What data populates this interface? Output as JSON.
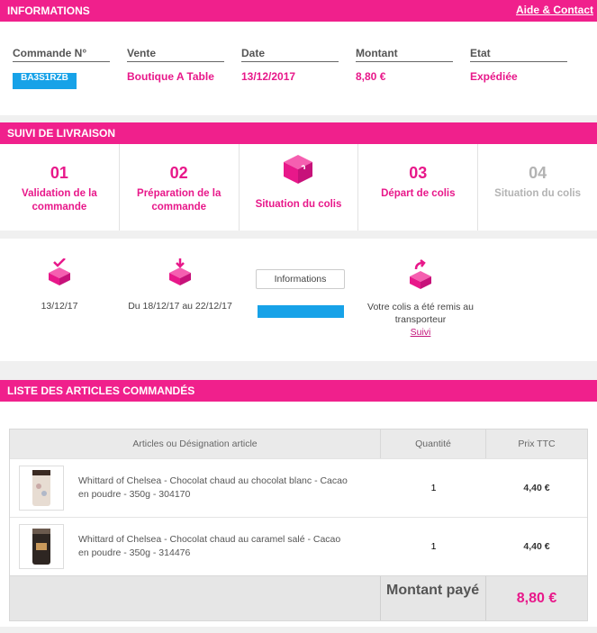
{
  "info": {
    "title": "INFORMATIONS",
    "help_link": "Aide & Contact",
    "columns": [
      {
        "label": "Commande N°",
        "value": "BA3S1RZB"
      },
      {
        "label": "Vente",
        "value": "Boutique A Table"
      },
      {
        "label": "Date",
        "value": "13/12/2017"
      },
      {
        "label": "Montant",
        "value": "8,80 €"
      },
      {
        "label": "Etat",
        "value": "Expédiée"
      }
    ]
  },
  "suivi": {
    "title": "SUIVI DE LIVRAISON",
    "steps": [
      {
        "num": "01",
        "label": "Validation de la commande"
      },
      {
        "num": "02",
        "label": "Préparation de la commande"
      },
      {
        "num": "",
        "label": "Situation du colis"
      },
      {
        "num": "03",
        "label": "Départ de colis"
      },
      {
        "num": "04",
        "label": "Situation du colis"
      }
    ],
    "track": {
      "date1": "13/12/17",
      "date2": "Du 18/12/17 au 22/12/17",
      "info_button": "Informations",
      "message": "Votre colis a été remis au transporteur",
      "link": "Suivi"
    }
  },
  "articles": {
    "title": "LISTE DES ARTICLES COMMANDÉS",
    "headers": [
      "Articles ou Désignation article",
      "Quantité",
      "Prix TTC"
    ],
    "rows": [
      {
        "desc": "Whittard of Chelsea - Chocolat chaud au chocolat blanc - Cacao en poudre - 350g - 304170",
        "qty": "1",
        "price": "4,40 €"
      },
      {
        "desc": "Whittard of Chelsea - Chocolat chaud au caramel salé - Cacao en poudre - 350g - 314476",
        "qty": "1",
        "price": "4,40 €"
      }
    ],
    "total_label": "Montant payé",
    "total_value": "8,80 €"
  },
  "colors": {
    "accent": "#f0208c",
    "blue": "#17a2e8"
  }
}
